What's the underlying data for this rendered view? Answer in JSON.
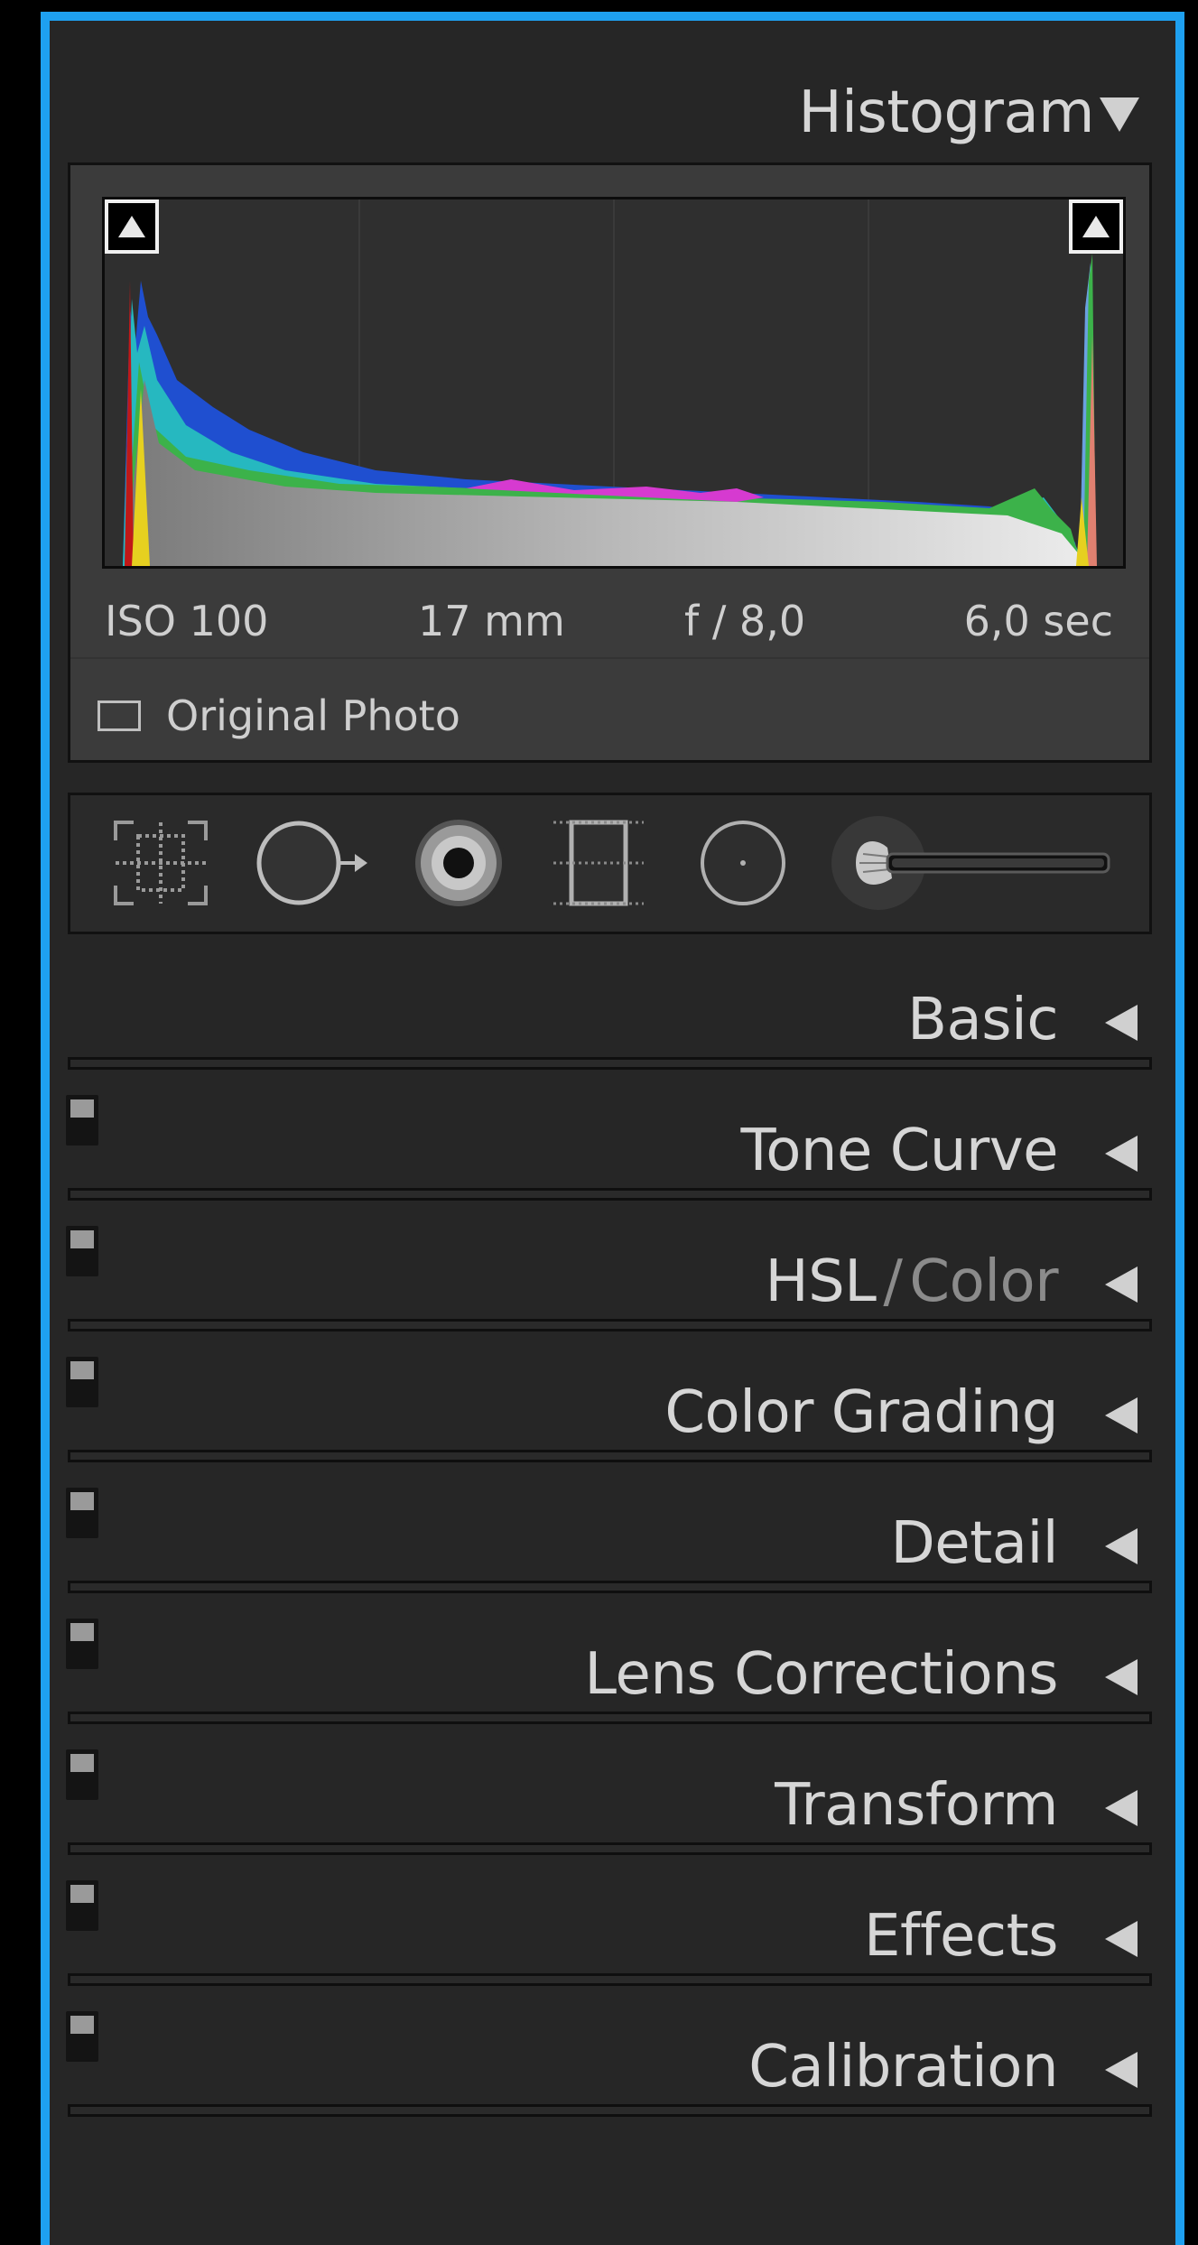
{
  "histogram": {
    "title": "Histogram",
    "exif": {
      "iso": "ISO 100",
      "focal": "17 mm",
      "aperture": "f / 8,0",
      "shutter": "6,0 sec"
    },
    "original_photo_label": "Original Photo",
    "original_photo_checked": false
  },
  "tools": [
    "crop-overlay-icon",
    "spot-removal-icon",
    "red-eye-icon",
    "graduated-filter-icon",
    "radial-filter-icon",
    "adjustment-brush-icon"
  ],
  "panels": [
    {
      "label": "Basic",
      "has_switch": false
    },
    {
      "label": "Tone Curve",
      "has_switch": true
    },
    {
      "label_main": "HSL",
      "label_sep": "/",
      "label_alt": "Color",
      "has_switch": true
    },
    {
      "label": "Color Grading",
      "has_switch": true
    },
    {
      "label": "Detail",
      "has_switch": true
    },
    {
      "label": "Lens Corrections",
      "has_switch": true
    },
    {
      "label": "Transform",
      "has_switch": true
    },
    {
      "label": "Effects",
      "has_switch": true
    },
    {
      "label": "Calibration",
      "has_switch": true
    }
  ],
  "colors": {
    "accent_border": "#1ea0f0",
    "panel_bg": "#262626"
  }
}
